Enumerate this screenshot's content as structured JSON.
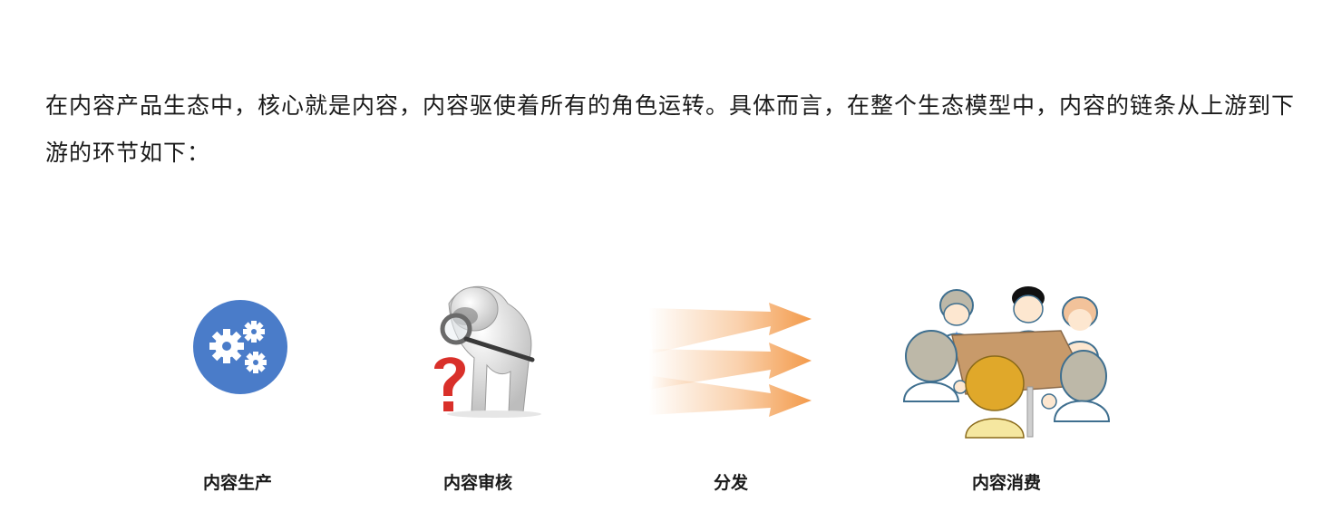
{
  "paragraph": "在内容产品生态中，核心就是内容，内容驱使着所有的角色运转。具体而言，在整个生态模型中，内容的链条从上游到下游的环节如下：",
  "steps": [
    {
      "label": "内容生产",
      "icon": "gears-icon"
    },
    {
      "label": "内容审核",
      "icon": "magnifier-question-icon"
    },
    {
      "label": "分发",
      "icon": "arrows-icon"
    },
    {
      "label": "内容消费",
      "icon": "meeting-people-icon"
    }
  ],
  "colors": {
    "gear_circle": "#4a7cc9",
    "arrow_orange": "#f39a4a",
    "question_red": "#d9302a",
    "table_brown": "#c89a6a"
  }
}
